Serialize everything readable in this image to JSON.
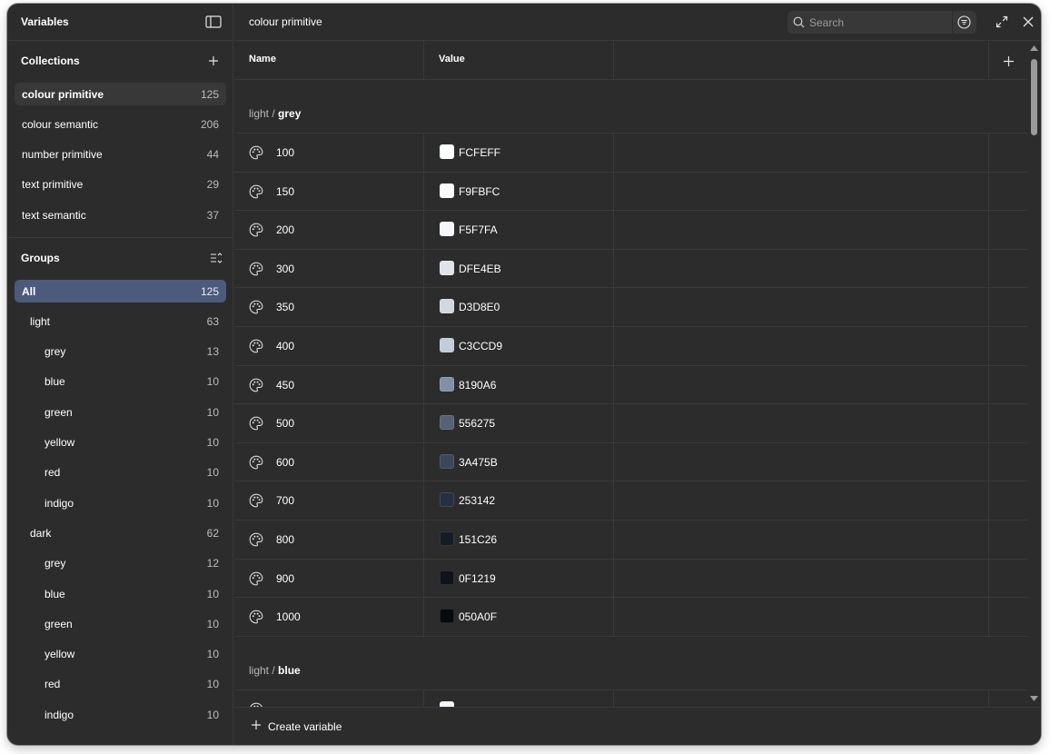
{
  "sidebar": {
    "title": "Variables",
    "collections_title": "Collections",
    "collections": [
      {
        "label": "colour primitive",
        "count": "125",
        "active": true
      },
      {
        "label": "colour semantic",
        "count": "206"
      },
      {
        "label": "number primitive",
        "count": "44"
      },
      {
        "label": "text primitive",
        "count": "29"
      },
      {
        "label": "text semantic",
        "count": "37"
      }
    ],
    "groups_title": "Groups",
    "groups": [
      {
        "label": "All",
        "count": "125",
        "level": 0,
        "active": true
      },
      {
        "label": "light",
        "count": "63",
        "level": 1
      },
      {
        "label": "grey",
        "count": "13",
        "level": 2
      },
      {
        "label": "blue",
        "count": "10",
        "level": 2
      },
      {
        "label": "green",
        "count": "10",
        "level": 2
      },
      {
        "label": "yellow",
        "count": "10",
        "level": 2
      },
      {
        "label": "red",
        "count": "10",
        "level": 2
      },
      {
        "label": "indigo",
        "count": "10",
        "level": 2
      },
      {
        "label": "dark",
        "count": "62",
        "level": 1
      },
      {
        "label": "grey",
        "count": "12",
        "level": 2
      },
      {
        "label": "blue",
        "count": "10",
        "level": 2
      },
      {
        "label": "green",
        "count": "10",
        "level": 2
      },
      {
        "label": "yellow",
        "count": "10",
        "level": 2
      },
      {
        "label": "red",
        "count": "10",
        "level": 2
      },
      {
        "label": "indigo",
        "count": "10",
        "level": 2
      }
    ]
  },
  "main": {
    "title": "colour primitive",
    "search": {
      "placeholder": "Search"
    },
    "columns": {
      "name": "Name",
      "value": "Value"
    },
    "sections": [
      {
        "prefix": "light /",
        "group": "grey",
        "rows": [
          {
            "name": "100",
            "value": "FCFEFF",
            "color": "#FCFEFF"
          },
          {
            "name": "150",
            "value": "F9FBFC",
            "color": "#F9FBFC"
          },
          {
            "name": "200",
            "value": "F5F7FA",
            "color": "#F5F7FA"
          },
          {
            "name": "300",
            "value": "DFE4EB",
            "color": "#DFE4EB"
          },
          {
            "name": "350",
            "value": "D3D8E0",
            "color": "#D3D8E0"
          },
          {
            "name": "400",
            "value": "C3CCD9",
            "color": "#C3CCD9"
          },
          {
            "name": "450",
            "value": "8190A6",
            "color": "#8190A6"
          },
          {
            "name": "500",
            "value": "556275",
            "color": "#556275"
          },
          {
            "name": "600",
            "value": "3A475B",
            "color": "#3A475B"
          },
          {
            "name": "700",
            "value": "253142",
            "color": "#253142"
          },
          {
            "name": "800",
            "value": "151C26",
            "color": "#151C26"
          },
          {
            "name": "900",
            "value": "0F1219",
            "color": "#0F1219"
          },
          {
            "name": "1000",
            "value": "050A0F",
            "color": "#050A0F"
          }
        ]
      },
      {
        "prefix": "light /",
        "group": "blue",
        "rows": [
          {
            "name": "",
            "value": "",
            "color": "#F2F6FF"
          }
        ]
      }
    ],
    "footer": {
      "create_label": "Create variable"
    }
  }
}
